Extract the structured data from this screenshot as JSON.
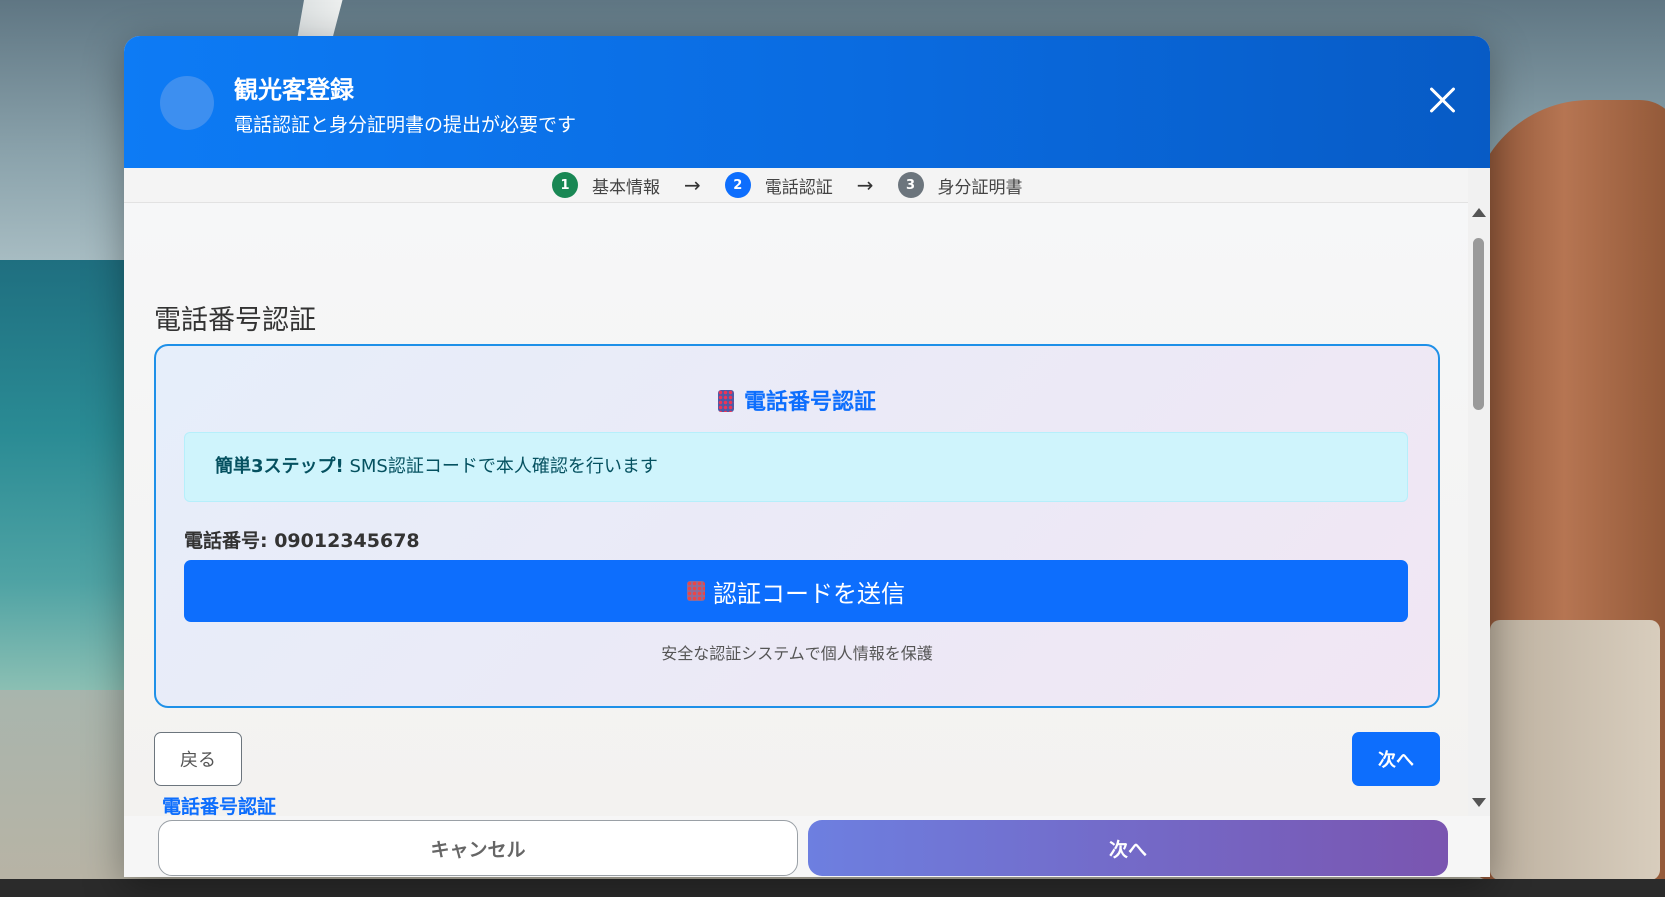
{
  "header": {
    "title": "観光客登録",
    "subtitle": "電話認証と身分証明書の提出が必要です"
  },
  "stepper": {
    "steps": [
      {
        "num": "1",
        "label": "基本情報",
        "color": "#198754"
      },
      {
        "num": "2",
        "label": "電話認証",
        "color": "#0d6efd"
      },
      {
        "num": "3",
        "label": "身分証明書",
        "color": "#6c757d"
      }
    ],
    "arrow": "→"
  },
  "section": {
    "title": "電話番号認証"
  },
  "card": {
    "title": "電話番号認証",
    "info_bold": "簡単3ステップ!",
    "info_text": " SMS認証コードで本人確認を行います",
    "phone_label": "電話番号: 09012345678",
    "send_button": "認証コードを送信",
    "security_note": "安全な認証システムで個人情報を保護"
  },
  "nav": {
    "back_label": "戻る",
    "step_label": "電話番号認証",
    "next_label": "次へ"
  },
  "footer": {
    "cancel_label": "キャンセル",
    "next_label": "次へ"
  },
  "colors": {
    "primary": "#0d6efd",
    "header_start": "#0d7bf5",
    "footer_next_start": "#6d7fe0",
    "footer_next_end": "#7a55b0"
  }
}
